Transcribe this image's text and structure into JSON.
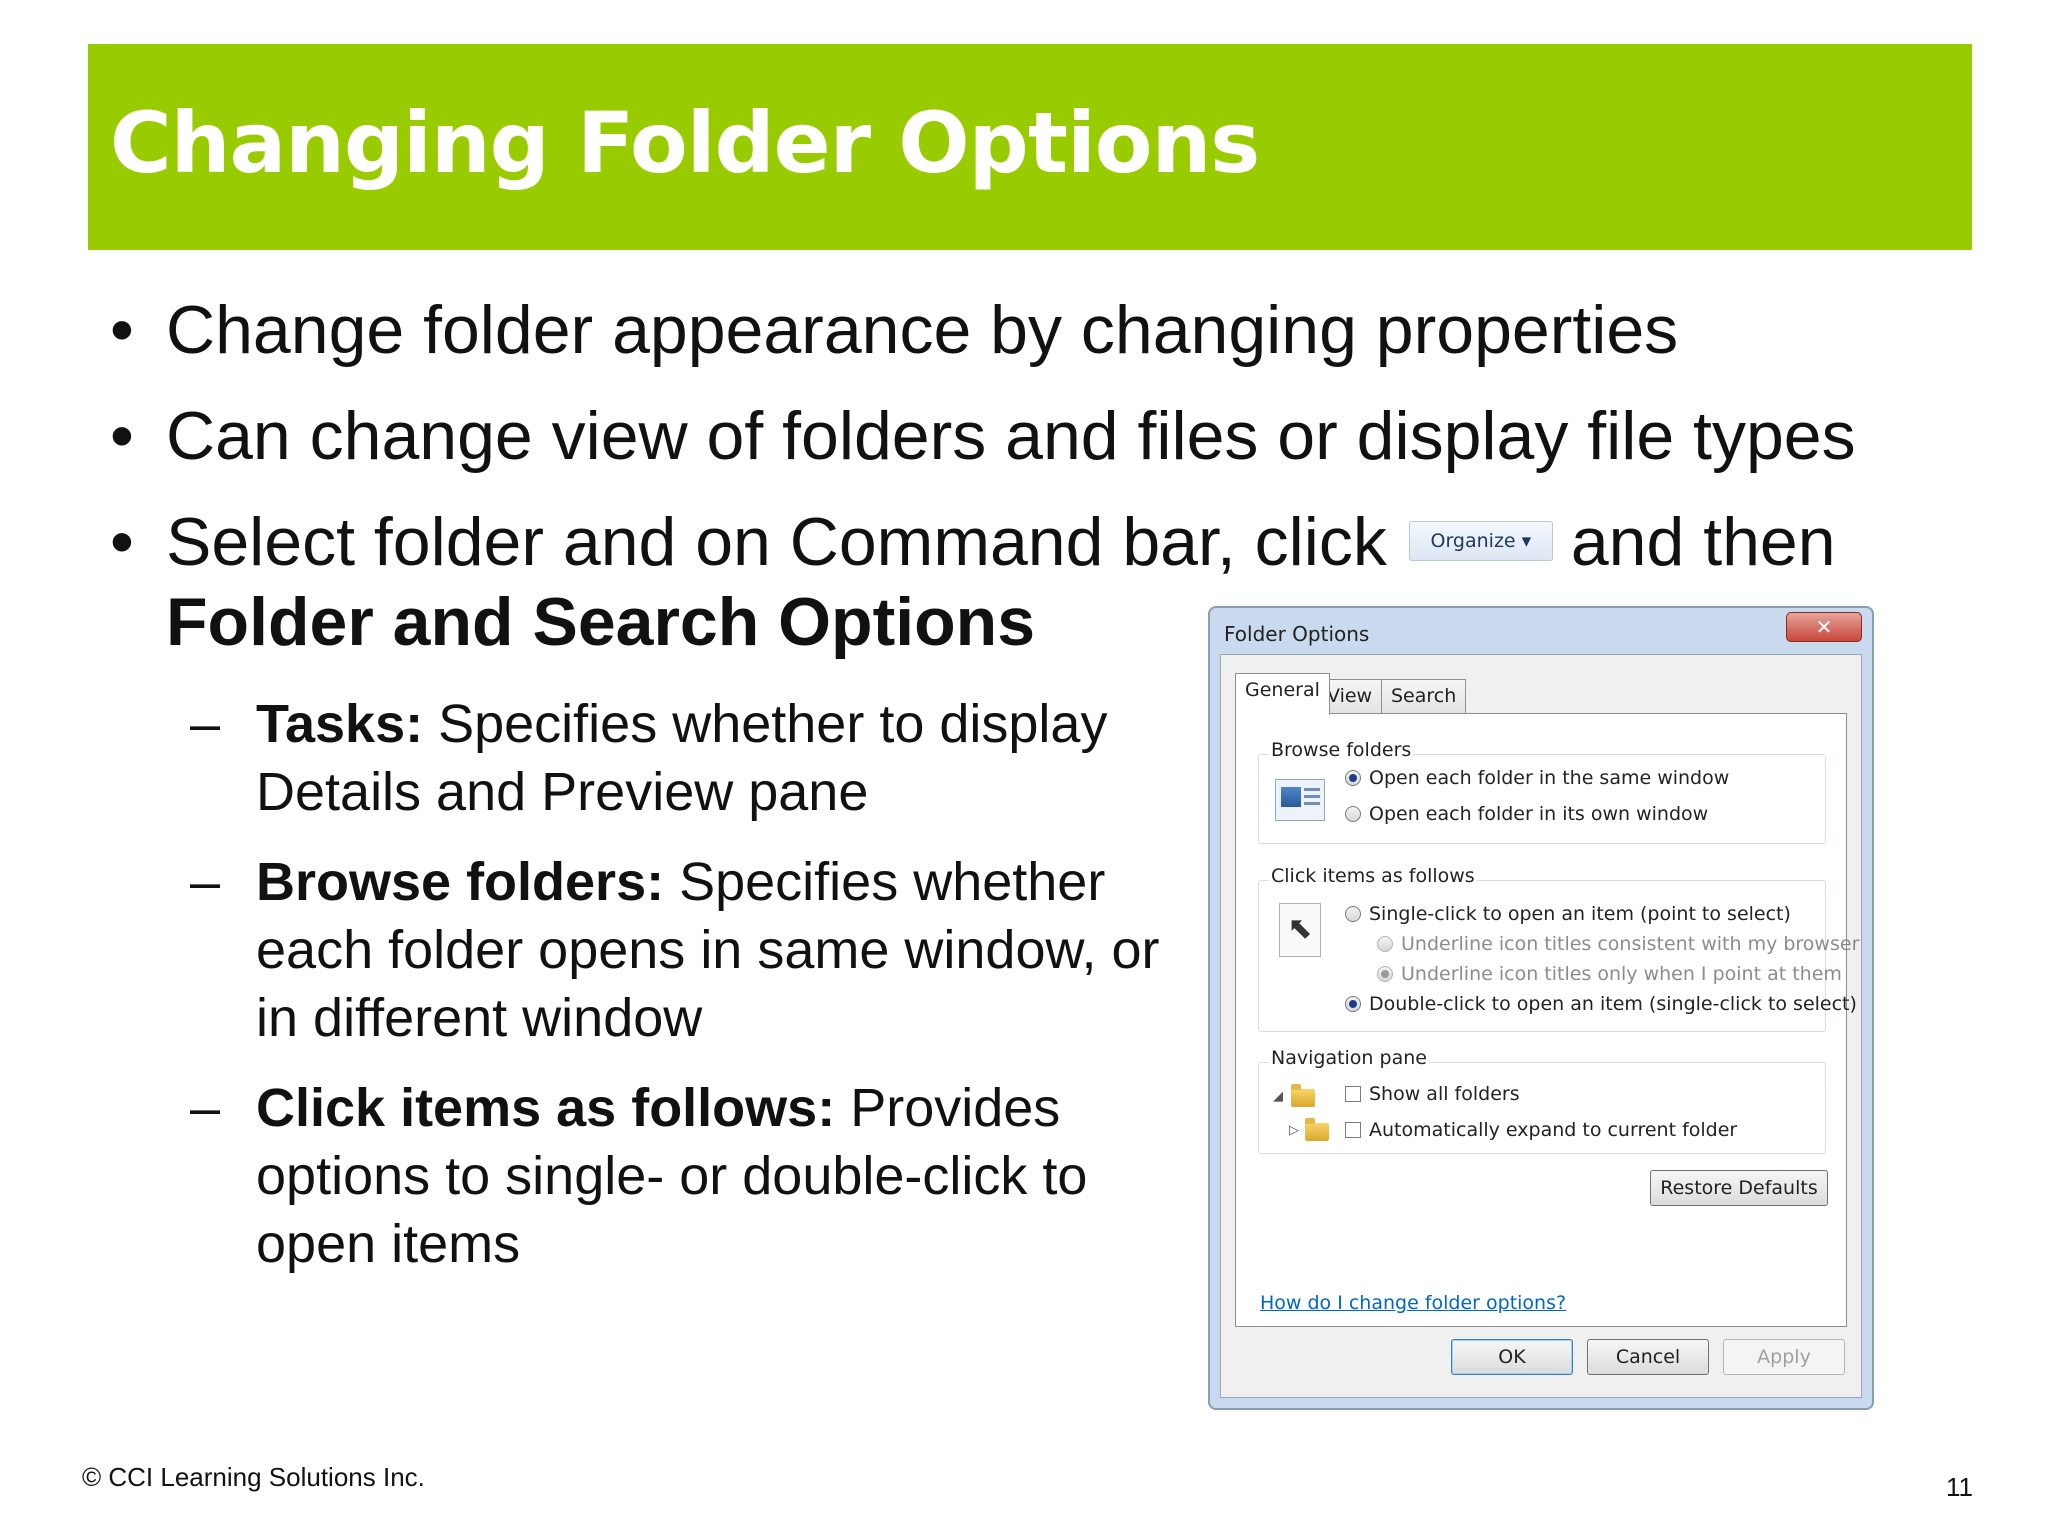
{
  "title": "Changing Folder Options",
  "colors": {
    "title_bar": "#99cc00",
    "title_text": "#ffffff",
    "link": "#0066cc"
  },
  "bullets": [
    {
      "text": "Change folder appearance by changing properties"
    },
    {
      "text": "Can change view of folders and files or display file types"
    },
    {
      "text_before": "Select folder and on Command bar, click",
      "button_label": "Organize",
      "text_after": "and then",
      "bold_text": "Folder and Search Options"
    }
  ],
  "sub_bullets": [
    {
      "term": "Tasks:",
      "text": " Specifies whether to display Details and Preview pane"
    },
    {
      "term": "Browse folders:",
      "text": " Specifies whether each folder opens in same window, or in different window"
    },
    {
      "term": "Click items as follows:",
      "text": " Provides options to single- or double-click to open items"
    }
  ],
  "dialog": {
    "title": "Folder Options",
    "close_glyph": "✕",
    "tabs": [
      "General",
      "View",
      "Search"
    ],
    "active_tab": "General",
    "browse_folders": {
      "label": "Browse folders",
      "options": [
        {
          "label": "Open each folder in the same window",
          "checked": true
        },
        {
          "label": "Open each folder in its own window",
          "checked": false
        }
      ]
    },
    "click_items": {
      "label": "Click items as follows",
      "options": [
        {
          "label": "Single-click to open an item (point to select)",
          "checked": false
        },
        {
          "label": "Underline icon titles consistent with my browser",
          "checked": false
        },
        {
          "label": "Underline icon titles only when I point at them",
          "checked": true
        },
        {
          "label": "Double-click to open an item (single-click to select)",
          "checked": true
        }
      ]
    },
    "navigation_pane": {
      "label": "Navigation pane",
      "options": [
        {
          "label": "Show all folders",
          "checked": false
        },
        {
          "label": "Automatically expand to current folder",
          "checked": false
        }
      ]
    },
    "restore_defaults": "Restore Defaults",
    "help_link": "How do I change folder options?",
    "buttons": {
      "ok": "OK",
      "cancel": "Cancel",
      "apply": "Apply"
    }
  },
  "footer": {
    "copyright": "© CCI Learning Solutions Inc.",
    "page_number": "11"
  }
}
